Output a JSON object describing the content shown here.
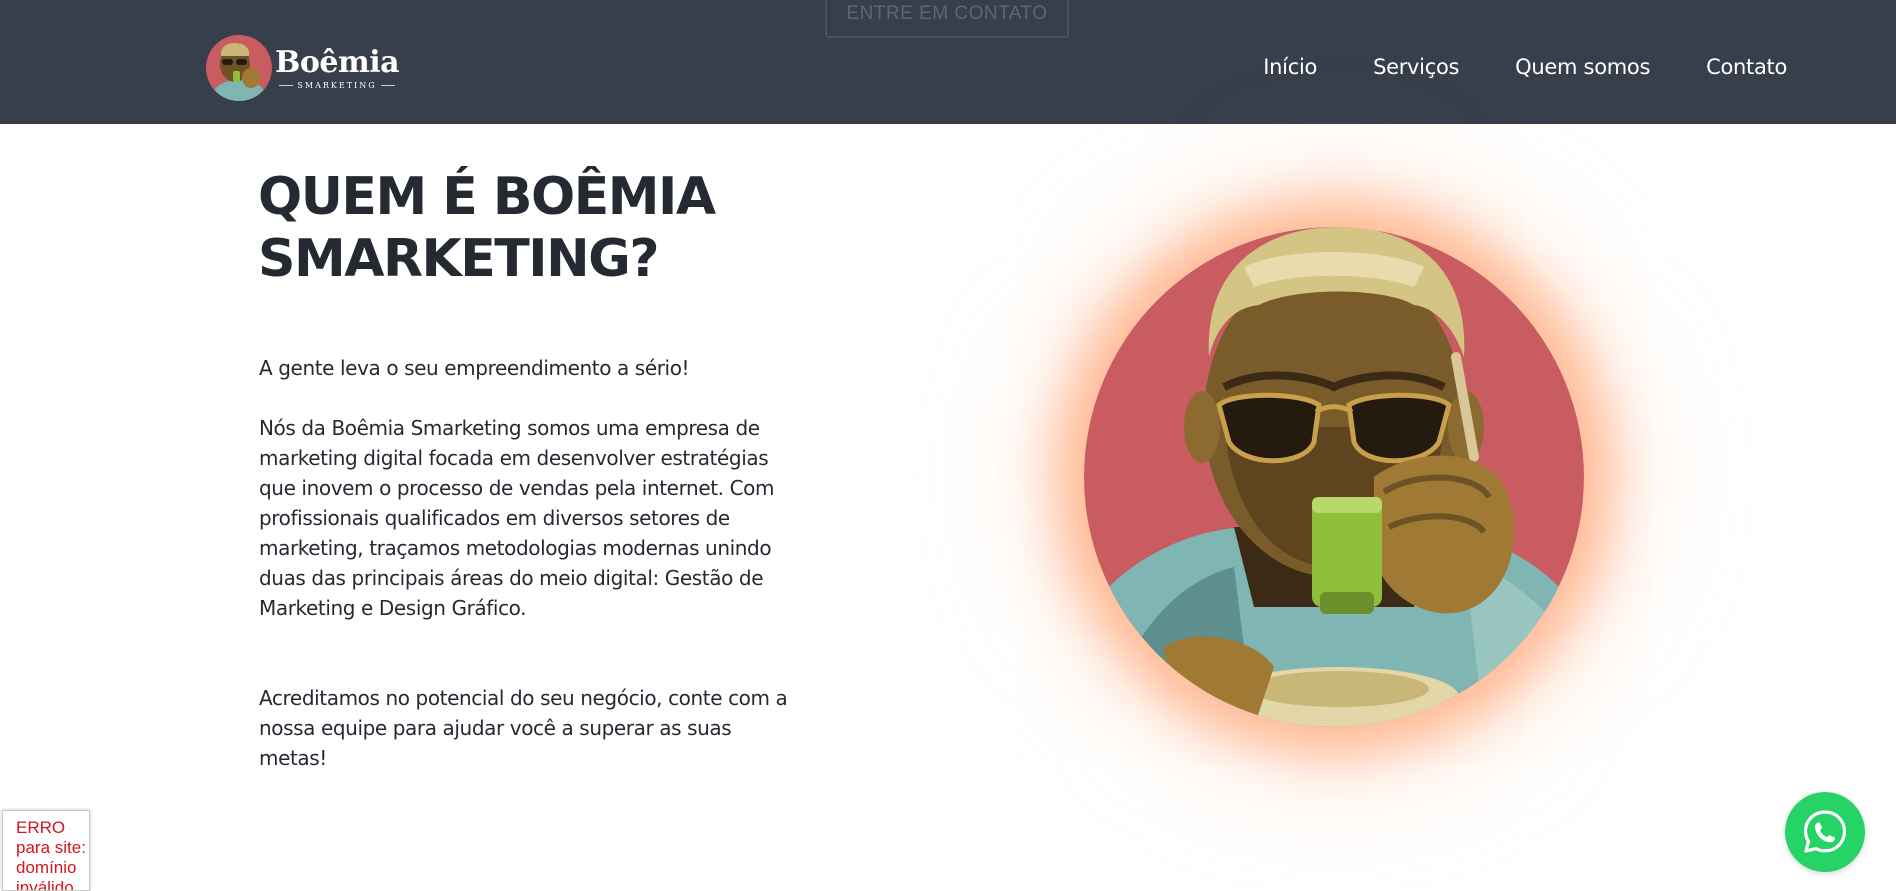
{
  "header": {
    "ghost_cta_label": "ENTRE EM CONTATO",
    "logo": {
      "wordmark": "Boêmia",
      "tagline": "SMARKETING",
      "icon": "boemia-logo-icon"
    },
    "nav": [
      {
        "label": "Início"
      },
      {
        "label": "Serviços"
      },
      {
        "label": "Quem somos"
      },
      {
        "label": "Contato"
      }
    ]
  },
  "about": {
    "title_line1": "QUEM É BOÊMIA",
    "title_line2": "SMARKETING?",
    "paragraph1": "A gente leva o seu empreendimento a sério!",
    "paragraph2": "Nós da Boêmia Smarketing somos uma empresa de marketing digital focada em desenvolver estratégias que inovem o processo de vendas pela internet. Com profissionais qualificados em diversos setores de marketing, traçamos metodologias modernas unindo duas das principais áreas do meio digital: Gestão de Marketing e Design Gráfico.",
    "paragraph3": "Acreditamos no potencial do seu negócio, conte com a nossa equipe para ajudar você a superar as suas metas!",
    "image_icon": "man-drinking-coffee-illustration"
  },
  "error_widget": {
    "text": "ERRO para site: domínio inválido do site"
  },
  "whatsapp": {
    "icon": "whatsapp-icon"
  },
  "colors": {
    "header_bg": "#373f4c",
    "text_dark": "#252a32",
    "accent_glow": "#ff8c50",
    "portrait_bg": "#c95c60",
    "whatsapp_green": "#25d366",
    "error_red": "#d4141c"
  }
}
